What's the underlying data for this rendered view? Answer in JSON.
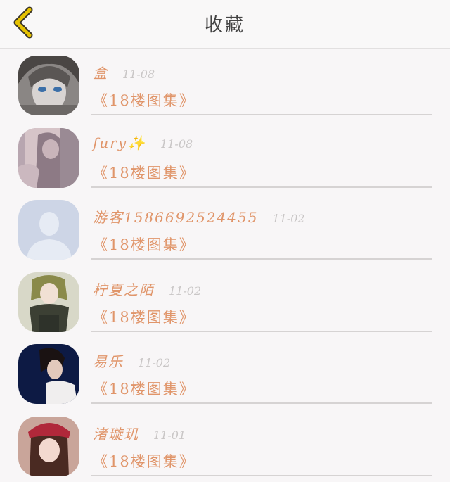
{
  "header": {
    "title": "收藏",
    "back_icon": "chevron-left-icon",
    "back_color": "#e6c200"
  },
  "favorites": [
    {
      "name": "盒",
      "date": "11-08",
      "work": "《18楼图集》",
      "avatar": "anime-girl-blue-eyes"
    },
    {
      "name": "fury✨",
      "date": "11-08",
      "work": "《18楼图集》",
      "avatar": "anime-girl-pink-hair"
    },
    {
      "name": "游客1586692524455",
      "date": "11-02",
      "work": "《18楼图集》",
      "avatar": "default-user"
    },
    {
      "name": "柠夏之陌",
      "date": "11-02",
      "work": "《18楼图集》",
      "avatar": "anime-girl-green-dress"
    },
    {
      "name": "易乐",
      "date": "11-02",
      "work": "《18楼图集》",
      "avatar": "boy-dark-background"
    },
    {
      "name": "渚璇玑",
      "date": "11-01",
      "work": "《18楼图集》",
      "avatar": "girl-red-cap"
    }
  ],
  "colors": {
    "accent": "#e0956a",
    "date": "#c9c6c6",
    "background": "#f8f6f7"
  }
}
